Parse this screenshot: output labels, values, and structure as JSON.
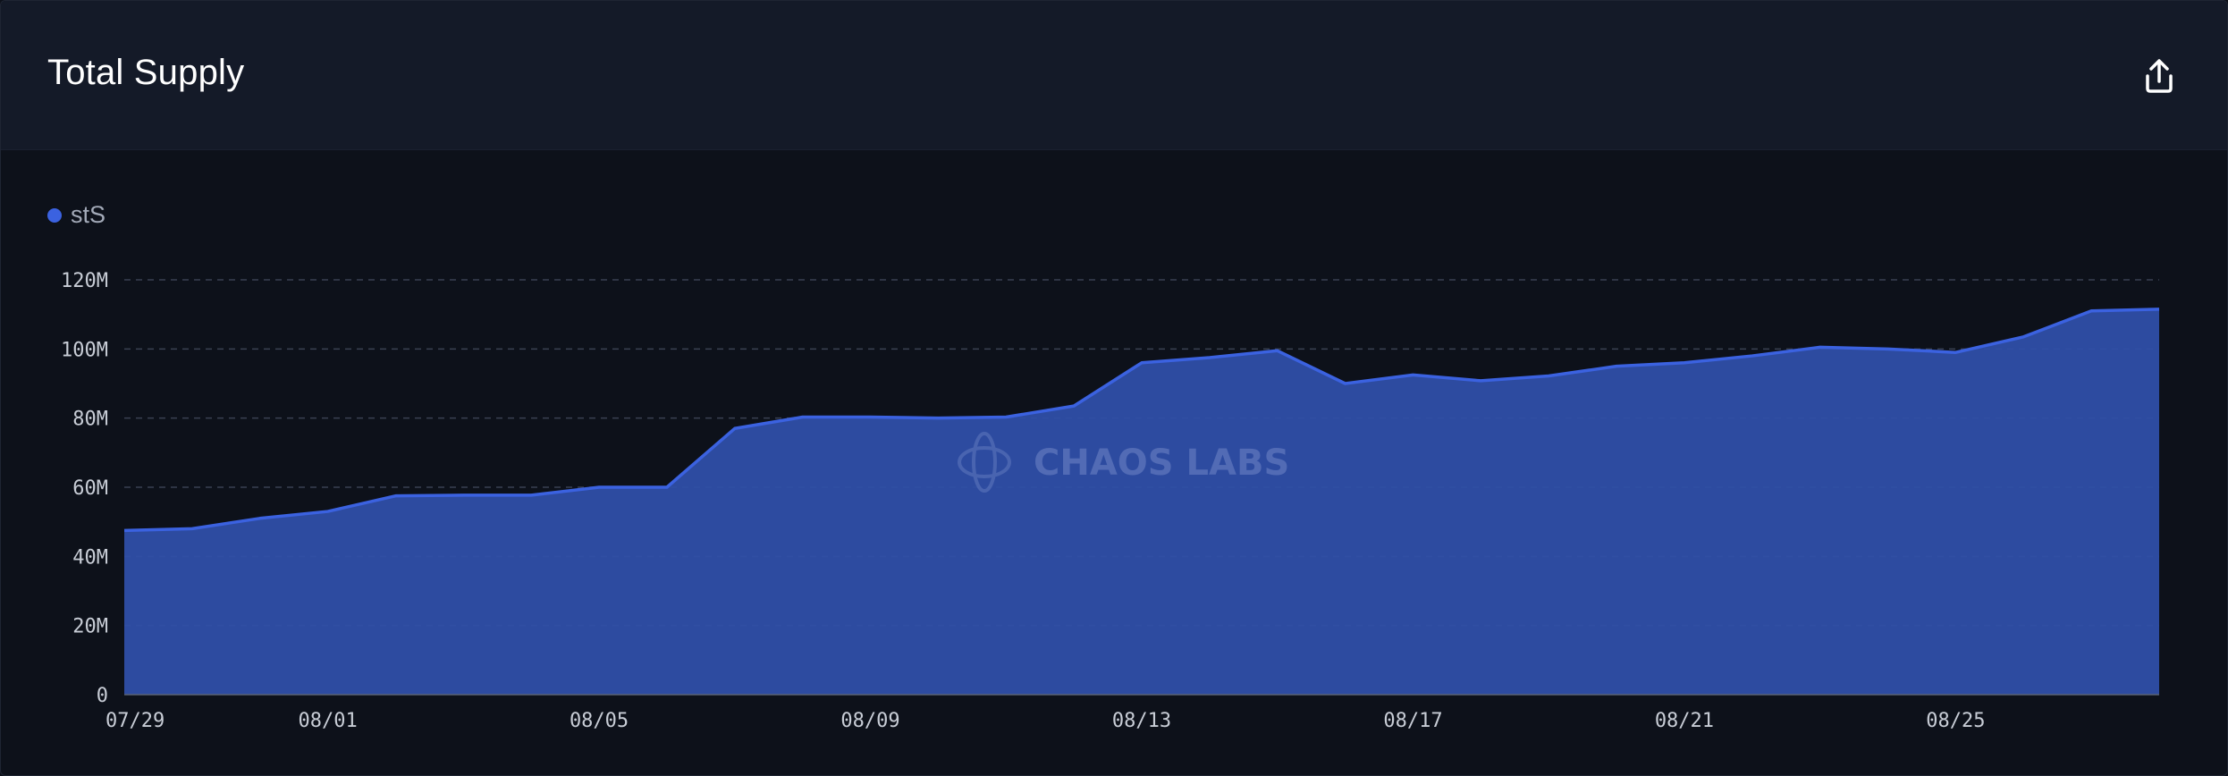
{
  "header": {
    "title": "Total Supply",
    "export_icon": "share-upload-icon"
  },
  "legend": {
    "label": "stS"
  },
  "watermark": {
    "text": "CHAOS LABS"
  },
  "colors": {
    "series": "#3b62e0",
    "fill": "#2f4fa8",
    "grid": "#3a4152",
    "text": "#c8cdd6",
    "header_bg": "#141a28",
    "body_bg": "#0d111a"
  },
  "chart_data": {
    "type": "area",
    "xlabel": "",
    "ylabel": "",
    "x": [
      "07/29",
      "07/30",
      "07/31",
      "08/01",
      "08/02",
      "08/03",
      "08/04",
      "08/05",
      "08/06",
      "08/07",
      "08/08",
      "08/09",
      "08/10",
      "08/11",
      "08/12",
      "08/13",
      "08/14",
      "08/15",
      "08/16",
      "08/17",
      "08/18",
      "08/19",
      "08/20",
      "08/21",
      "08/22",
      "08/23",
      "08/24",
      "08/25",
      "08/26",
      "08/27",
      "08/28"
    ],
    "x_tick_labels": [
      "07/29",
      "08/01",
      "08/05",
      "08/09",
      "08/13",
      "08/17",
      "08/21",
      "08/25"
    ],
    "series": [
      {
        "name": "stS",
        "values": [
          47.5,
          48,
          51,
          53,
          57.5,
          57.7,
          57.7,
          60,
          60,
          77,
          80.3,
          80.3,
          80,
          80.3,
          83.5,
          96,
          97.5,
          99.5,
          90,
          92.5,
          90.8,
          92.2,
          95,
          96,
          98,
          100.5,
          100,
          99,
          103.5,
          111,
          111.5
        ]
      }
    ],
    "ylim": [
      0,
      120
    ],
    "y_ticks": [
      0,
      20,
      40,
      60,
      80,
      100,
      120
    ],
    "y_tick_labels": [
      "0",
      "20M",
      "40M",
      "60M",
      "80M",
      "100M",
      "120M"
    ],
    "grid": true,
    "legend_position": "top-left"
  }
}
